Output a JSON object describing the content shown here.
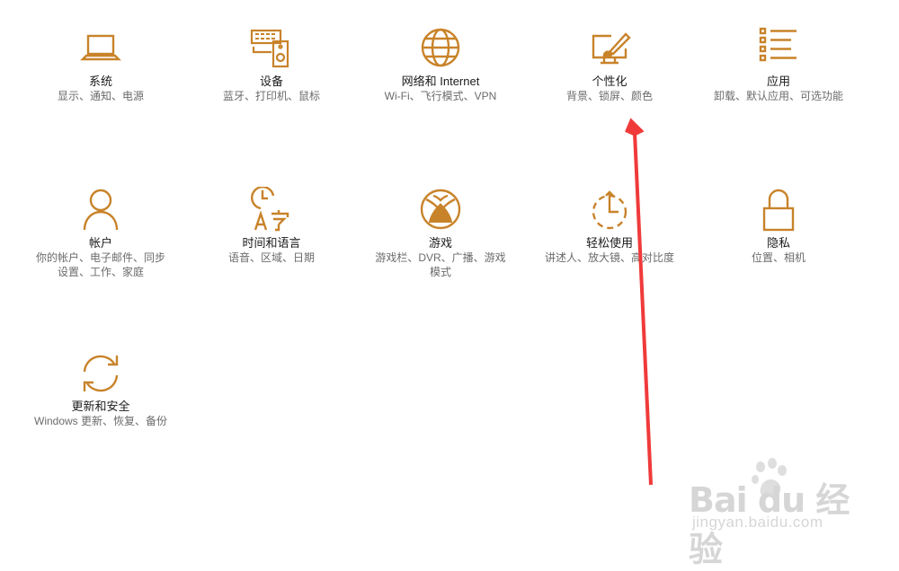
{
  "accent": "#c8832a",
  "tiles": [
    {
      "title": "系统",
      "desc": "显示、通知、电源",
      "icon": "laptop-icon"
    },
    {
      "title": "设备",
      "desc": "蓝牙、打印机、鼠标",
      "icon": "devices-icon"
    },
    {
      "title": "网络和 Internet",
      "desc": "Wi-Fi、飞行模式、VPN",
      "icon": "globe-icon"
    },
    {
      "title": "个性化",
      "desc": "背景、锁屏、颜色",
      "icon": "paintbrush-monitor-icon"
    },
    {
      "title": "应用",
      "desc": "卸载、默认应用、可选功能",
      "icon": "list-icon"
    },
    {
      "title": "帐户",
      "desc": "你的帐户、电子邮件、同步设置、工作、家庭",
      "icon": "person-icon"
    },
    {
      "title": "时间和语言",
      "desc": "语音、区域、日期",
      "icon": "clock-language-icon"
    },
    {
      "title": "游戏",
      "desc": "游戏栏、DVR、广播、游戏模式",
      "icon": "xbox-icon"
    },
    {
      "title": "轻松使用",
      "desc": "讲述人、放大镜、高对比度",
      "icon": "timer-icon"
    },
    {
      "title": "隐私",
      "desc": "位置、相机",
      "icon": "lock-icon"
    },
    {
      "title": "更新和安全",
      "desc": "Windows 更新、恢复、备份",
      "icon": "sync-icon"
    }
  ],
  "annotation": {
    "color": "#f03a3a",
    "icon": "red-arrow-icon"
  },
  "watermark": {
    "main": "Bai du 经验",
    "sub": "jingyan.baidu.com"
  }
}
